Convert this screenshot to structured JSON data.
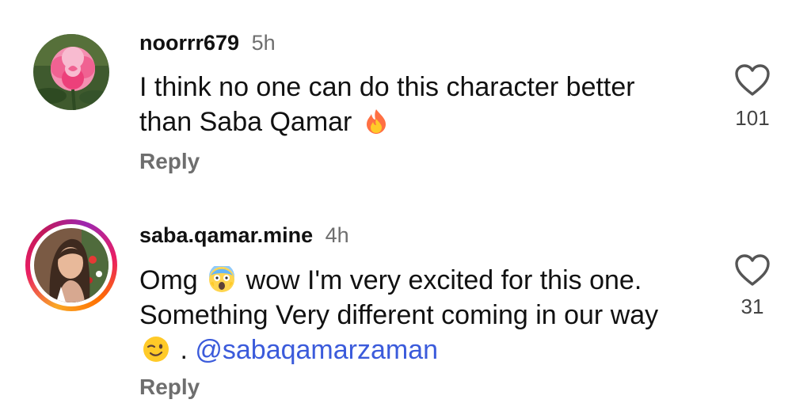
{
  "comments": [
    {
      "username": "noorrr679",
      "time": "5h",
      "text": "I think no one can do this character better than Saba Qamar",
      "emoji_after": "fire-emoji",
      "likes": "101",
      "reply_label": "Reply",
      "avatar": "rose-avatar",
      "has_story_ring": false
    },
    {
      "username": "saba.qamar.mine",
      "time": "4h",
      "text_part1": "Omg",
      "emoji_mid": "screaming-face-emoji",
      "text_part2": "wow I'm very excited for this one. Something Very different coming in our way",
      "emoji_end": "winking-face-emoji",
      "text_part3": ".",
      "mention": "@sabaqamarzaman",
      "likes": "31",
      "reply_label": "Reply",
      "avatar": "woman-portrait-avatar",
      "has_story_ring": true
    }
  ],
  "colors": {
    "username": "#111111",
    "timestamp": "#6e6e6e",
    "mention": "#3b5bdb",
    "reply": "#6e6e6e",
    "heart_outline": "#555555"
  }
}
